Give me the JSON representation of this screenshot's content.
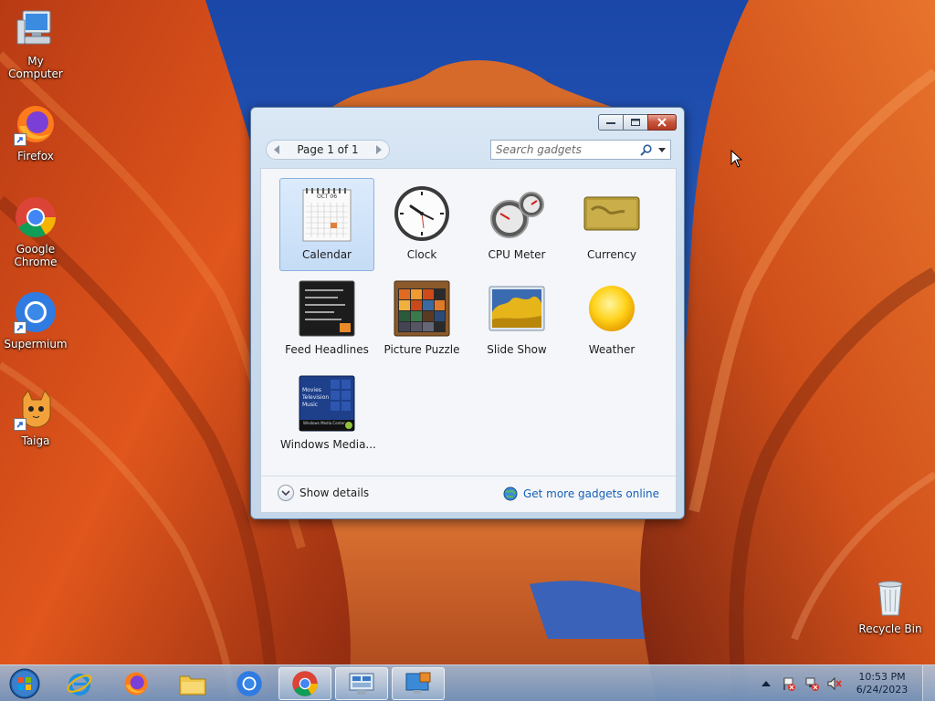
{
  "desktop": {
    "icons": [
      {
        "label": "My Computer",
        "icon": "computer-icon"
      },
      {
        "label": "Firefox",
        "icon": "firefox-icon"
      },
      {
        "label": "Google Chrome",
        "icon": "chrome-icon"
      },
      {
        "label": "Supermium",
        "icon": "supermium-icon"
      },
      {
        "label": "Taiga",
        "icon": "taiga-icon"
      },
      {
        "label": "Recycle Bin",
        "icon": "recycle-bin-icon"
      }
    ]
  },
  "gadgets_window": {
    "page_label": "Page 1 of 1",
    "search_placeholder": "Search gadgets",
    "gadgets": [
      {
        "label": "Calendar",
        "selected": true
      },
      {
        "label": "Clock"
      },
      {
        "label": "CPU Meter"
      },
      {
        "label": "Currency"
      },
      {
        "label": "Feed Headlines"
      },
      {
        "label": "Picture Puzzle"
      },
      {
        "label": "Slide Show"
      },
      {
        "label": "Weather"
      },
      {
        "label": "Windows Media..."
      }
    ],
    "calendar_month": "OCT 06",
    "media_center_lines": [
      "Movies",
      "Television",
      "Music"
    ],
    "media_center_footer": "Windows Media Center",
    "show_details_label": "Show details",
    "get_more_label": "Get more gadgets online"
  },
  "taskbar": {
    "buttons": [
      {
        "icon": "start-orb-icon"
      },
      {
        "icon": "internet-explorer-icon"
      },
      {
        "icon": "firefox-icon"
      },
      {
        "icon": "file-explorer-icon"
      },
      {
        "icon": "supermium-icon"
      },
      {
        "icon": "chrome-icon",
        "active": true
      },
      {
        "icon": "control-panel-icon",
        "active": true
      },
      {
        "icon": "gadgets-icon",
        "active": true
      }
    ],
    "tray": {
      "icons": [
        "show-hidden-icons-arrow",
        "action-center-icon",
        "network-icon",
        "volume-muted-icon"
      ],
      "time": "10:53 PM",
      "date": "6/24/2023"
    }
  },
  "colors": {
    "sky": "#1f5cc0",
    "rock_orange": "#e0561c",
    "window_frame": "#c7daee",
    "link_blue": "#1660b8"
  }
}
